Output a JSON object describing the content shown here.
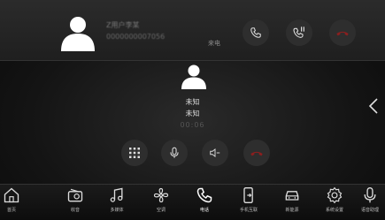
{
  "incoming_call": {
    "caller_name": "Z用户李某",
    "caller_number": "0000000007056",
    "status": "来电"
  },
  "active_call": {
    "name": "未知",
    "number": "未知",
    "duration": "00:06"
  },
  "dock": {
    "items": [
      {
        "label": "首页",
        "icon": "home-icon"
      },
      {
        "label": "收音",
        "icon": "radio-icon"
      },
      {
        "label": "多媒体",
        "icon": "music-icon"
      },
      {
        "label": "空调",
        "icon": "fan-icon"
      },
      {
        "label": "电话",
        "icon": "phone-icon"
      },
      {
        "label": "手机互联",
        "icon": "phone-link-icon"
      },
      {
        "label": "新能源",
        "icon": "car-icon"
      },
      {
        "label": "系统设置",
        "icon": "gear-icon"
      },
      {
        "label": "语音助理",
        "icon": "mic-icon"
      }
    ],
    "active_index": 4
  },
  "colors": {
    "reject": "#8a1f1f",
    "icon": "#dddddd"
  }
}
